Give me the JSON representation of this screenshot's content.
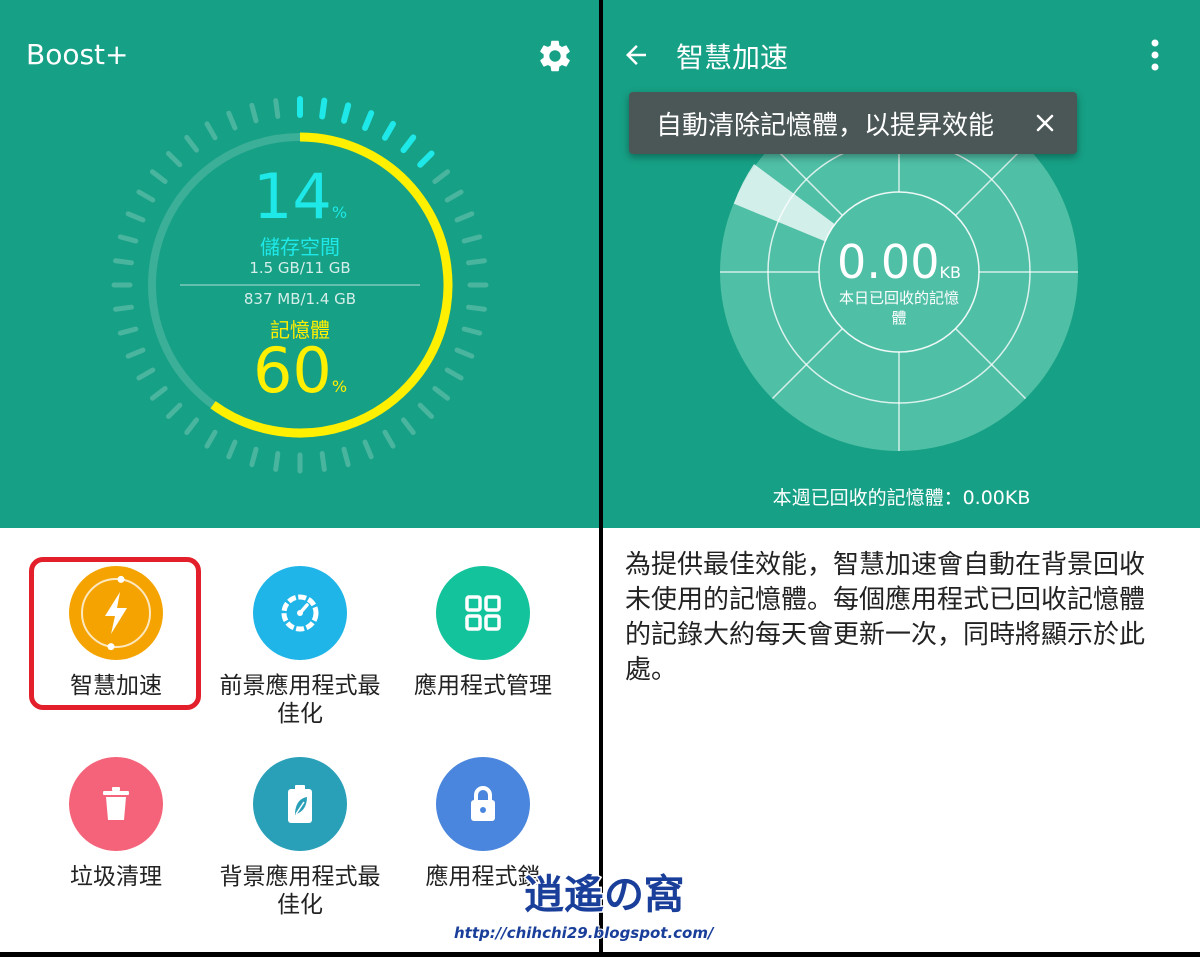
{
  "left": {
    "app_title": "Boost+",
    "storage": {
      "percent_num": "14",
      "percent_sign": "%",
      "label": "儲存空間",
      "usage": "1.5 GB/11 GB"
    },
    "memory": {
      "usage": "837 MB/1.4 GB",
      "label": "記憶體",
      "percent_num": "60",
      "percent_sign": "%"
    },
    "tiles": [
      {
        "label": "智慧加速",
        "icon": "lightning-icon",
        "color": "#f5a300",
        "selected": true
      },
      {
        "label": "前景應用程式最佳化",
        "icon": "speedometer-icon",
        "color": "#1fb5e8"
      },
      {
        "label": "應用程式管理",
        "icon": "grid-icon",
        "color": "#13c39c"
      },
      {
        "label": "垃圾清理",
        "icon": "trash-icon",
        "color": "#f5637a"
      },
      {
        "label": "背景應用程式最佳化",
        "icon": "battery-leaf-icon",
        "color": "#2aa0b8"
      },
      {
        "label": "應用程式鎖",
        "icon": "lock-icon",
        "color": "#4a86dd"
      }
    ],
    "colors": {
      "header": "#16a085",
      "storage_accent": "#1ee8e8",
      "memory_accent": "#ffef00",
      "highlight": "#e21f2a"
    }
  },
  "right": {
    "title": "智慧加速",
    "tooltip": "自動清除記憶體，以提昇效能",
    "radar_value": "0.00",
    "radar_unit": "KB",
    "radar_label": "本日已回收的記憶體",
    "weekly": "本週已回收的記憶體：0.00KB",
    "description": "為提供最佳效能，智慧加速會自動在背景回收未使用的記憶體。每個應用程式已回收記憶體的記錄大約每天會更新一次，同時將顯示於此處。"
  },
  "watermark": {
    "logo_text": "逍遙の窩",
    "url": "http://chihchi29.blogspot.com/"
  }
}
